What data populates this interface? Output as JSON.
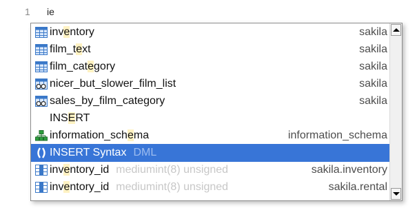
{
  "editor": {
    "line_number": "1",
    "code_text": "ie"
  },
  "colors": {
    "selection": "#3875d7",
    "match_highlight": "#fff2c2",
    "type_text": "#c7c7c7"
  },
  "popup": {
    "items": [
      {
        "icon": "table-icon",
        "name_parts": [
          "inv",
          "e",
          "ntory"
        ],
        "type": "",
        "schema": "sakila",
        "selected": false
      },
      {
        "icon": "table-icon",
        "name_parts": [
          "film_t",
          "e",
          "xt"
        ],
        "type": "",
        "schema": "sakila",
        "selected": false
      },
      {
        "icon": "table-icon",
        "name_parts": [
          "film_cat",
          "e",
          "gory"
        ],
        "type": "",
        "schema": "sakila",
        "selected": false
      },
      {
        "icon": "view-icon",
        "name_parts": [
          "nicer_but_slower_film_list",
          "",
          ""
        ],
        "type": "",
        "schema": "sakila",
        "selected": false
      },
      {
        "icon": "view-icon",
        "name_parts": [
          "sales_by_film_category",
          "",
          ""
        ],
        "type": "",
        "schema": "sakila",
        "selected": false
      },
      {
        "icon": "",
        "name_parts": [
          "INS",
          "E",
          "RT"
        ],
        "type": "",
        "schema": "",
        "selected": false
      },
      {
        "icon": "schema-icon",
        "name_parts": [
          "information_sch",
          "e",
          "ma"
        ],
        "type": "",
        "schema": "information_schema",
        "selected": false
      },
      {
        "icon": "syntax-icon",
        "name_parts": [
          "INS",
          "E",
          "RT Syntax"
        ],
        "type": "DML",
        "schema": "",
        "selected": true
      },
      {
        "icon": "column-icon",
        "name_parts": [
          "inv",
          "e",
          "ntory_id"
        ],
        "type": "mediumint(8) unsigned",
        "schema": "sakila.inventory",
        "selected": false
      },
      {
        "icon": "column-icon",
        "name_parts": [
          "inv",
          "e",
          "ntory_id"
        ],
        "type": "mediumint(8) unsigned",
        "schema": "sakila.rental",
        "selected": false
      }
    ]
  }
}
